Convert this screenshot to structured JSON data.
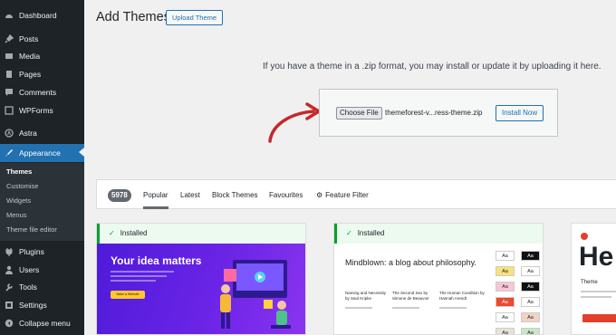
{
  "sidebar": {
    "items": [
      {
        "label": "Dashboard",
        "icon": "dashboard-icon"
      },
      {
        "label": "Posts",
        "icon": "pin-icon"
      },
      {
        "label": "Media",
        "icon": "media-icon"
      },
      {
        "label": "Pages",
        "icon": "pages-icon"
      },
      {
        "label": "Comments",
        "icon": "comment-icon"
      },
      {
        "label": "WPForms",
        "icon": "form-icon"
      },
      {
        "label": "Astra",
        "icon": "astra-icon"
      },
      {
        "label": "Appearance",
        "icon": "brush-icon"
      },
      {
        "label": "Plugins",
        "icon": "plug-icon"
      },
      {
        "label": "Users",
        "icon": "user-icon"
      },
      {
        "label": "Tools",
        "icon": "wrench-icon"
      },
      {
        "label": "Settings",
        "icon": "settings-icon"
      },
      {
        "label": "Collapse menu",
        "icon": "collapse-icon"
      }
    ],
    "submenu": [
      "Themes",
      "Customise",
      "Widgets",
      "Menus",
      "Theme file editor"
    ],
    "accent_color": "#2271b1"
  },
  "header": {
    "title": "Add Themes",
    "upload_button": "Upload Theme"
  },
  "upload": {
    "help_text": "If you have a theme in a .zip format, you may install or update it by uploading it here.",
    "choose_button": "Choose File",
    "file_name": "themeforest-v...ress-theme.zip",
    "install_button": "Install Now"
  },
  "filter_bar": {
    "count": "5978",
    "tabs": [
      "Popular",
      "Latest",
      "Block Themes",
      "Favourites"
    ],
    "feature_filter": "Feature Filter"
  },
  "themes": [
    {
      "installed_label": "Installed",
      "headline": "Your idea matters",
      "cta": "Make a Website"
    },
    {
      "installed_label": "Installed",
      "headline": "Mindblown: a blog about philosophy.",
      "posts": [
        "Naming and Necessity by Saul Kripke",
        "The Second Sex by Simone de Beauvoir",
        "The Human Condition by Hannah Arendt"
      ],
      "swatch_text": "Aa"
    },
    {
      "headline": "He",
      "label": "Theme"
    }
  ]
}
